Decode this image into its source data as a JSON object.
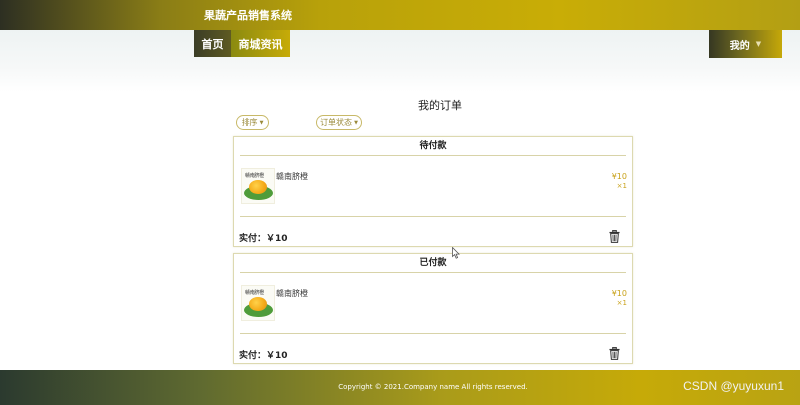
{
  "app": {
    "title": "果蔬产品销售系统"
  },
  "nav": {
    "home": "首页",
    "news": "商城资讯",
    "mine": "我的"
  },
  "page": {
    "title": "我的订单"
  },
  "filters": {
    "sort": "排序",
    "status": "订单状态"
  },
  "orders": [
    {
      "status": "待付款",
      "product_name": "赣南脐橙",
      "price": "¥10",
      "qty": "×1",
      "paid": "实付：￥10",
      "thumb_label": "赣南脐橙"
    },
    {
      "status": "已付款",
      "product_name": "赣南脐橙",
      "price": "¥10",
      "qty": "×1",
      "paid": "实付：￥10",
      "thumb_label": "赣南脐橙"
    }
  ],
  "footer": {
    "copyright": "Copyright © 2021.Company name All rights reserved."
  },
  "watermark": "CSDN @yuyuxun1",
  "colors": {
    "accent": "#c9ad06",
    "dark": "#2d2f22",
    "price": "#c9a21a"
  },
  "icons": {
    "trash": "trash-icon",
    "caret": "caret-down-icon"
  }
}
